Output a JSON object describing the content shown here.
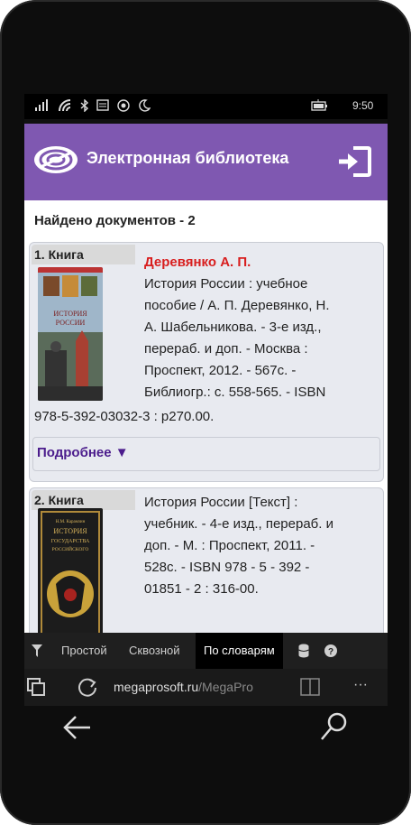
{
  "status": {
    "time": "9:50"
  },
  "app": {
    "title": "Электронная библиотека"
  },
  "results": {
    "found_label": "Найдено документов - 2"
  },
  "cards": [
    {
      "index_label": "1. Книга",
      "author": "Деревянко А. П.",
      "lines": [
        "История России : учебное",
        "пособие / А. П. Деревянко, Н.",
        "А. Шабельникова. - 3-е изд.,",
        "перераб. и доп. - Москва :",
        "Проспект, 2012. - 567с. -",
        "Библиогр.: с. 558-565. - ISBN"
      ],
      "tail": "978-5-392-03032-3 : р270.00.",
      "more": "Подробнее ▼",
      "cover_text": [
        "ИСТОРИЯ",
        "РОССИИ"
      ]
    },
    {
      "index_label": "2. Книга",
      "lines": [
        "История России [Текст] :",
        "учебник. - 4-е изд., перераб. и",
        "доп. - М. : Проспект, 2011. -",
        "528с. - ISBN 978 - 5 - 392 -",
        "01851 - 2 : 316-00."
      ],
      "cover_text": [
        "Н.М. Карамзин",
        "ИСТОРИЯ",
        "ГОСУДАРСТВА",
        "РОССИЙСКОГО"
      ]
    }
  ],
  "tabs": {
    "simple": "Простой",
    "through": "Сквозной",
    "dicts": "По словарям"
  },
  "browser": {
    "url_main": "megaprosoft.ru",
    "url_rest": "/MegaPro",
    "menu": "···"
  },
  "colors": {
    "header": "#7f58b1",
    "author": "#d81e1e",
    "more": "#4b1c8c"
  },
  "icons": [
    "signal-icon",
    "wifi-icon",
    "bluetooth-icon",
    "message-icon",
    "location-icon",
    "moon-icon",
    "battery-icon",
    "logo-icon",
    "login-icon",
    "filter-icon",
    "database-icon",
    "help-icon",
    "tabs-icon",
    "refresh-icon",
    "reading-view-icon",
    "back-icon",
    "search-icon"
  ]
}
